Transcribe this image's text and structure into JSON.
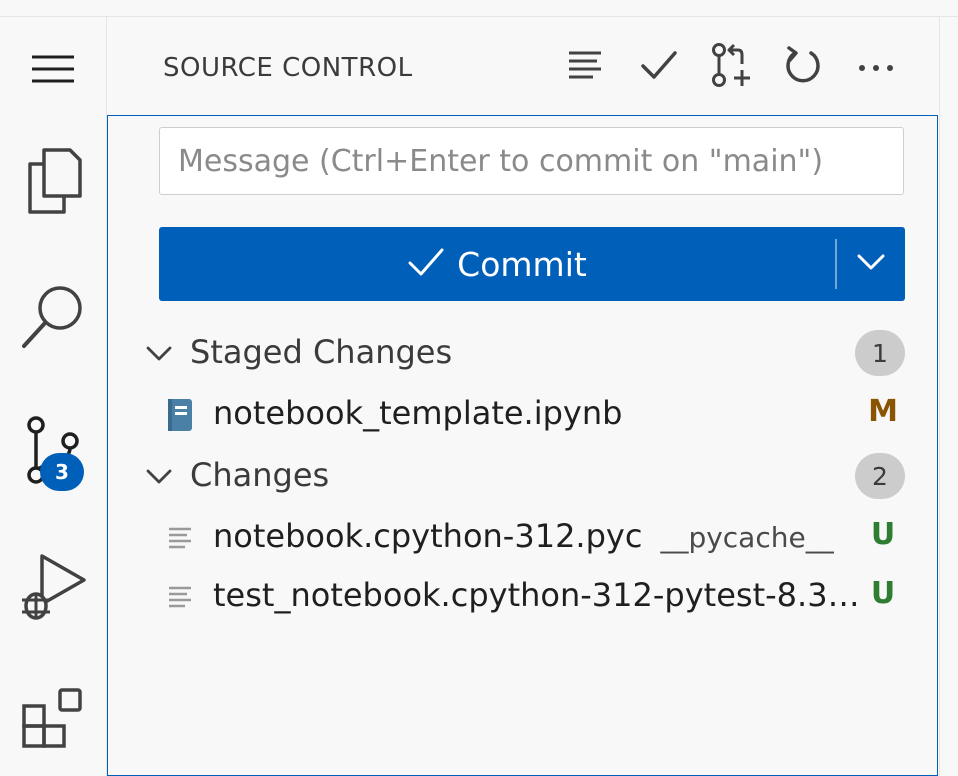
{
  "colors": {
    "accent": "#005fb8",
    "badge_bg": "#cccccc",
    "modified": "#895503",
    "untracked": "#2e7d32",
    "notebook_icon": "#4a7fa6"
  },
  "activity_bar": {
    "items": [
      {
        "name": "menu",
        "icon": "hamburger-icon"
      },
      {
        "name": "explorer",
        "icon": "files-icon"
      },
      {
        "name": "search",
        "icon": "search-icon"
      },
      {
        "name": "source-control",
        "icon": "source-control-icon",
        "badge": "3"
      },
      {
        "name": "run-and-debug",
        "icon": "run-debug-icon"
      },
      {
        "name": "extensions",
        "icon": "extensions-icon"
      }
    ]
  },
  "panel": {
    "title": "SOURCE CONTROL",
    "actions": [
      {
        "name": "view-as-tree",
        "icon": "list-icon"
      },
      {
        "name": "commit",
        "icon": "check-icon"
      },
      {
        "name": "create-pull-request",
        "icon": "pull-request-icon"
      },
      {
        "name": "refresh",
        "icon": "refresh-icon"
      },
      {
        "name": "more-actions",
        "icon": "ellipsis-icon"
      }
    ]
  },
  "commit": {
    "message_value": "",
    "message_placeholder": "Message (Ctrl+Enter to commit on \"main\")",
    "button_label": "Commit"
  },
  "groups": {
    "staged": {
      "label": "Staged Changes",
      "count": "1",
      "files": [
        {
          "name": "notebook_template.ipynb",
          "description": "",
          "status": "M",
          "icon": "notebook-icon"
        }
      ]
    },
    "changes": {
      "label": "Changes",
      "count": "2",
      "files": [
        {
          "name": "notebook.cpython-312.pyc",
          "description": "__pycache__",
          "status": "U",
          "icon": "file-lines-icon"
        },
        {
          "name": "test_notebook.cpython-312-pytest-8.3....",
          "description": "",
          "status": "U",
          "icon": "file-lines-icon"
        }
      ]
    }
  }
}
